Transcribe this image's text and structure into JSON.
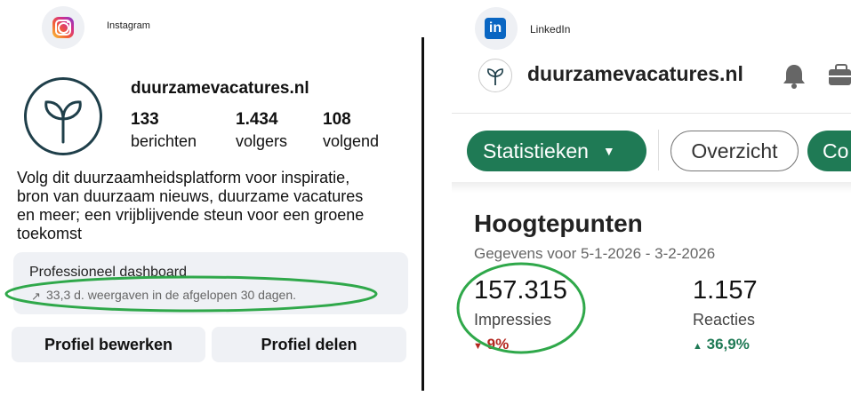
{
  "instagram": {
    "app_label": "Instagram",
    "username": "duurzamevacatures.nl",
    "stats": [
      {
        "value": "133",
        "label": "berichten"
      },
      {
        "value": "1.434",
        "label": "volgers"
      },
      {
        "value": "108",
        "label": "volgend"
      }
    ],
    "bio_lines": [
      "Volg dit duurzaamheidsplatform voor inspiratie,",
      "bron van duurzaam nieuws, duurzame vacatures",
      "en meer; een vrijblijvende steun voor een groene",
      "toekomst"
    ],
    "dashboard": {
      "title": "Professioneel dashboard",
      "subtitle": "33,3 d. weergaven in de afgelopen 30 dagen."
    },
    "buttons": {
      "edit": "Profiel bewerken",
      "share": "Profiel delen"
    }
  },
  "linkedin": {
    "app_label": "LinkedIn",
    "company": "duurzamevacatures.nl",
    "tabs": {
      "stats": "Statistieken",
      "overview": "Overzicht",
      "partial": "Co"
    },
    "highlights": {
      "title": "Hoogtepunten",
      "range": "Gegevens voor 5-1-2026 - 3-2-2026",
      "impressions": {
        "value": "157.315",
        "label": "Impressies",
        "trend": "9%",
        "direction": "down"
      },
      "reactions": {
        "value": "1.157",
        "label": "Reacties",
        "trend": "36,9%",
        "direction": "up"
      }
    }
  },
  "colors": {
    "linkedin_green": "#1f7a55",
    "highlight_circle": "#2fa84a",
    "trend_down": "#b3261e",
    "trend_up": "#1f7a55"
  }
}
